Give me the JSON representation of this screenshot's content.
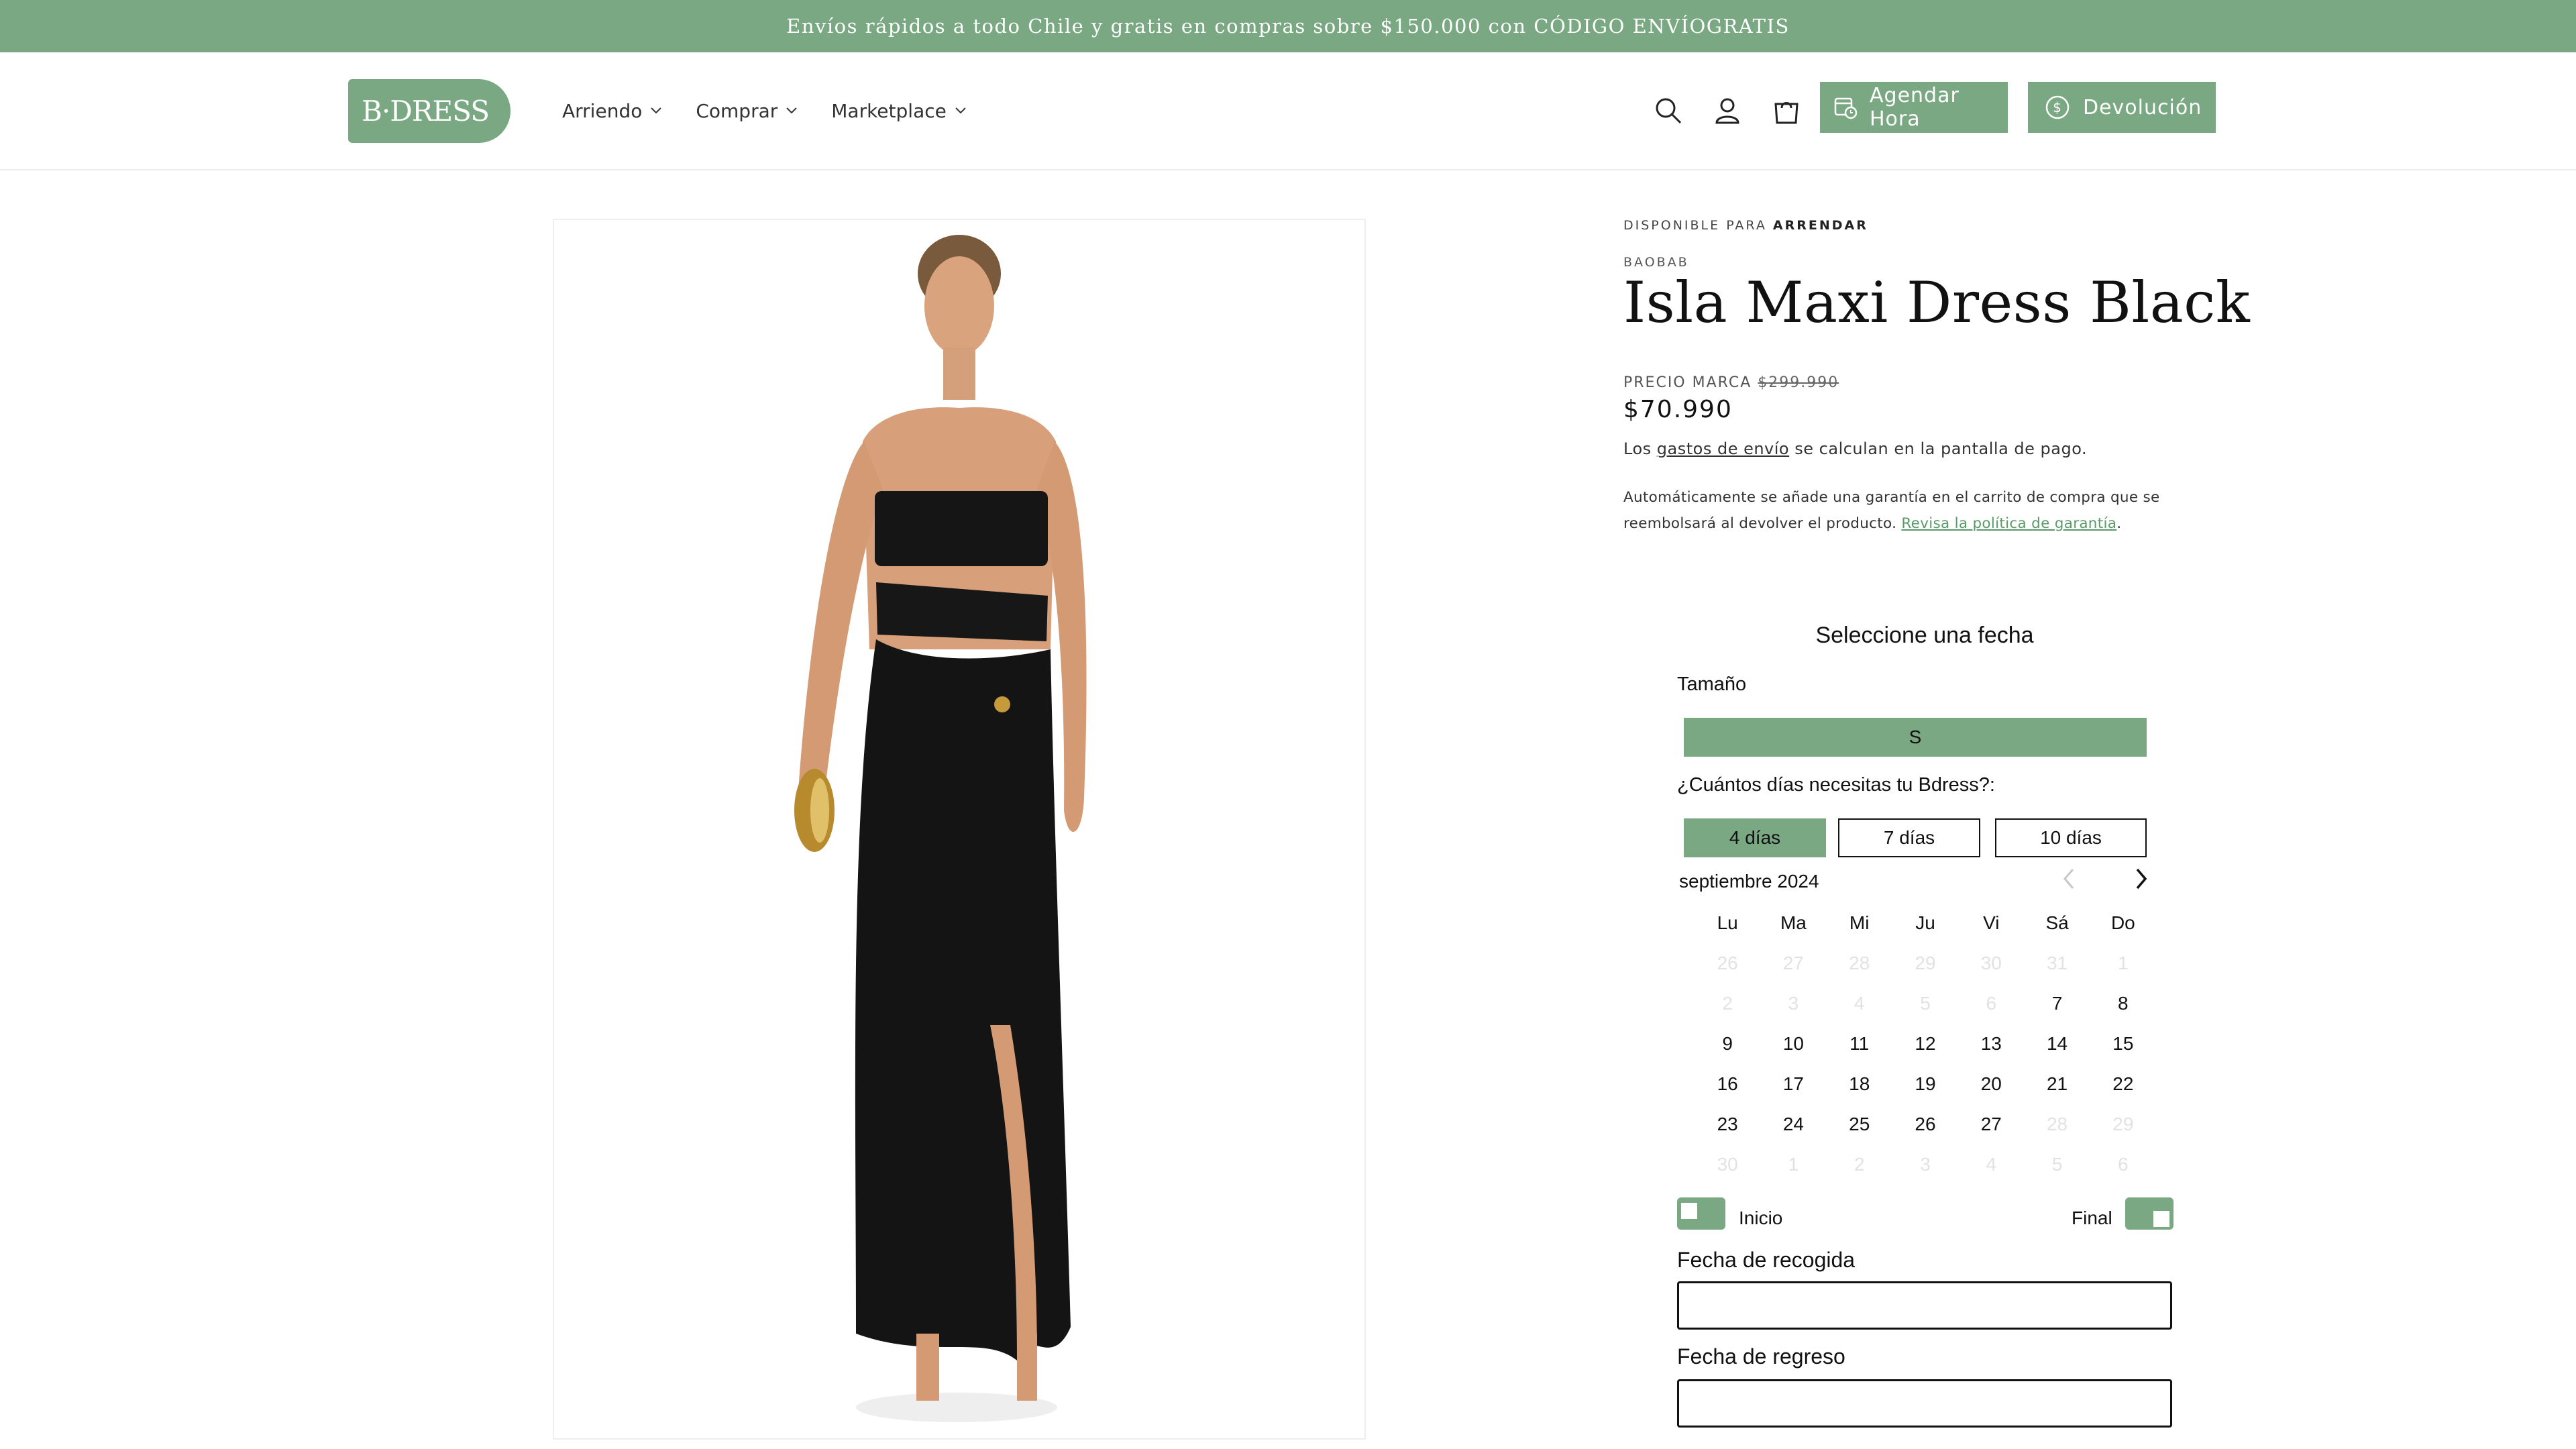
{
  "announcement": "Envíos rápidos a todo Chile y gratis en compras sobre $150.000 con CÓDIGO ENVÍOGRATIS",
  "brand": {
    "logo_text": "B·DRESS",
    "accent_color": "#79a882"
  },
  "nav": {
    "items": [
      {
        "label": "Arriendo"
      },
      {
        "label": "Comprar"
      },
      {
        "label": "Marketplace"
      }
    ]
  },
  "header": {
    "icons": [
      "search-icon",
      "account-icon",
      "cart-icon"
    ],
    "schedule_button": "Agendar Hora",
    "return_button": "Devolución"
  },
  "product": {
    "availability_prefix": "DISPONIBLE PARA",
    "availability_mode": "ARRENDAR",
    "brand": "BAOBAB",
    "title": "Isla Maxi Dress Black",
    "brand_price_label": "PRECIO MARCA",
    "brand_price": "$299.990",
    "price": "$70.990",
    "shipping_prefix": "Los",
    "shipping_link": "gastos de envío",
    "shipping_suffix": "se calculan en la pantalla de pago.",
    "warranty_text": "Automáticamente se añade una garantía en el carrito de compra que se reembolsará al devolver el producto.",
    "warranty_link": "Revisa la política de garantía",
    "warranty_end": "."
  },
  "booking": {
    "title": "Seleccione una fecha",
    "size_label": "Tamaño",
    "size_value": "S",
    "days_label": "¿Cuántos días necesitas tu Bdress?:",
    "day_options": [
      "4 días",
      "7 días",
      "10 días"
    ],
    "selected_days": "4 días",
    "month": "septiembre 2024",
    "weekdays": [
      "Lu",
      "Ma",
      "Mi",
      "Ju",
      "Vi",
      "Sá",
      "Do"
    ],
    "weeks": [
      [
        {
          "d": "26",
          "m": true
        },
        {
          "d": "27",
          "m": true
        },
        {
          "d": "28",
          "m": true
        },
        {
          "d": "29",
          "m": true
        },
        {
          "d": "30",
          "m": true
        },
        {
          "d": "31",
          "m": true
        },
        {
          "d": "1",
          "m": true
        }
      ],
      [
        {
          "d": "2",
          "m": true
        },
        {
          "d": "3",
          "m": true
        },
        {
          "d": "4",
          "m": true
        },
        {
          "d": "5",
          "m": true
        },
        {
          "d": "6",
          "m": true
        },
        {
          "d": "7",
          "m": false
        },
        {
          "d": "8",
          "m": false
        }
      ],
      [
        {
          "d": "9",
          "m": false
        },
        {
          "d": "10",
          "m": false
        },
        {
          "d": "11",
          "m": false
        },
        {
          "d": "12",
          "m": false
        },
        {
          "d": "13",
          "m": false
        },
        {
          "d": "14",
          "m": false
        },
        {
          "d": "15",
          "m": false
        }
      ],
      [
        {
          "d": "16",
          "m": false
        },
        {
          "d": "17",
          "m": false
        },
        {
          "d": "18",
          "m": false
        },
        {
          "d": "19",
          "m": false
        },
        {
          "d": "20",
          "m": false
        },
        {
          "d": "21",
          "m": false
        },
        {
          "d": "22",
          "m": false
        }
      ],
      [
        {
          "d": "23",
          "m": false
        },
        {
          "d": "24",
          "m": false
        },
        {
          "d": "25",
          "m": false
        },
        {
          "d": "26",
          "m": false
        },
        {
          "d": "27",
          "m": false
        },
        {
          "d": "28",
          "m": true
        },
        {
          "d": "29",
          "m": true
        }
      ],
      [
        {
          "d": "30",
          "m": true
        },
        {
          "d": "1",
          "m": true
        },
        {
          "d": "2",
          "m": true
        },
        {
          "d": "3",
          "m": true
        },
        {
          "d": "4",
          "m": true
        },
        {
          "d": "5",
          "m": true
        },
        {
          "d": "6",
          "m": true
        }
      ]
    ],
    "start_label": "Inicio",
    "end_label": "Final",
    "pickup_label": "Fecha de recogida",
    "pickup_value": "",
    "return_label": "Fecha de regreso",
    "return_value": ""
  }
}
